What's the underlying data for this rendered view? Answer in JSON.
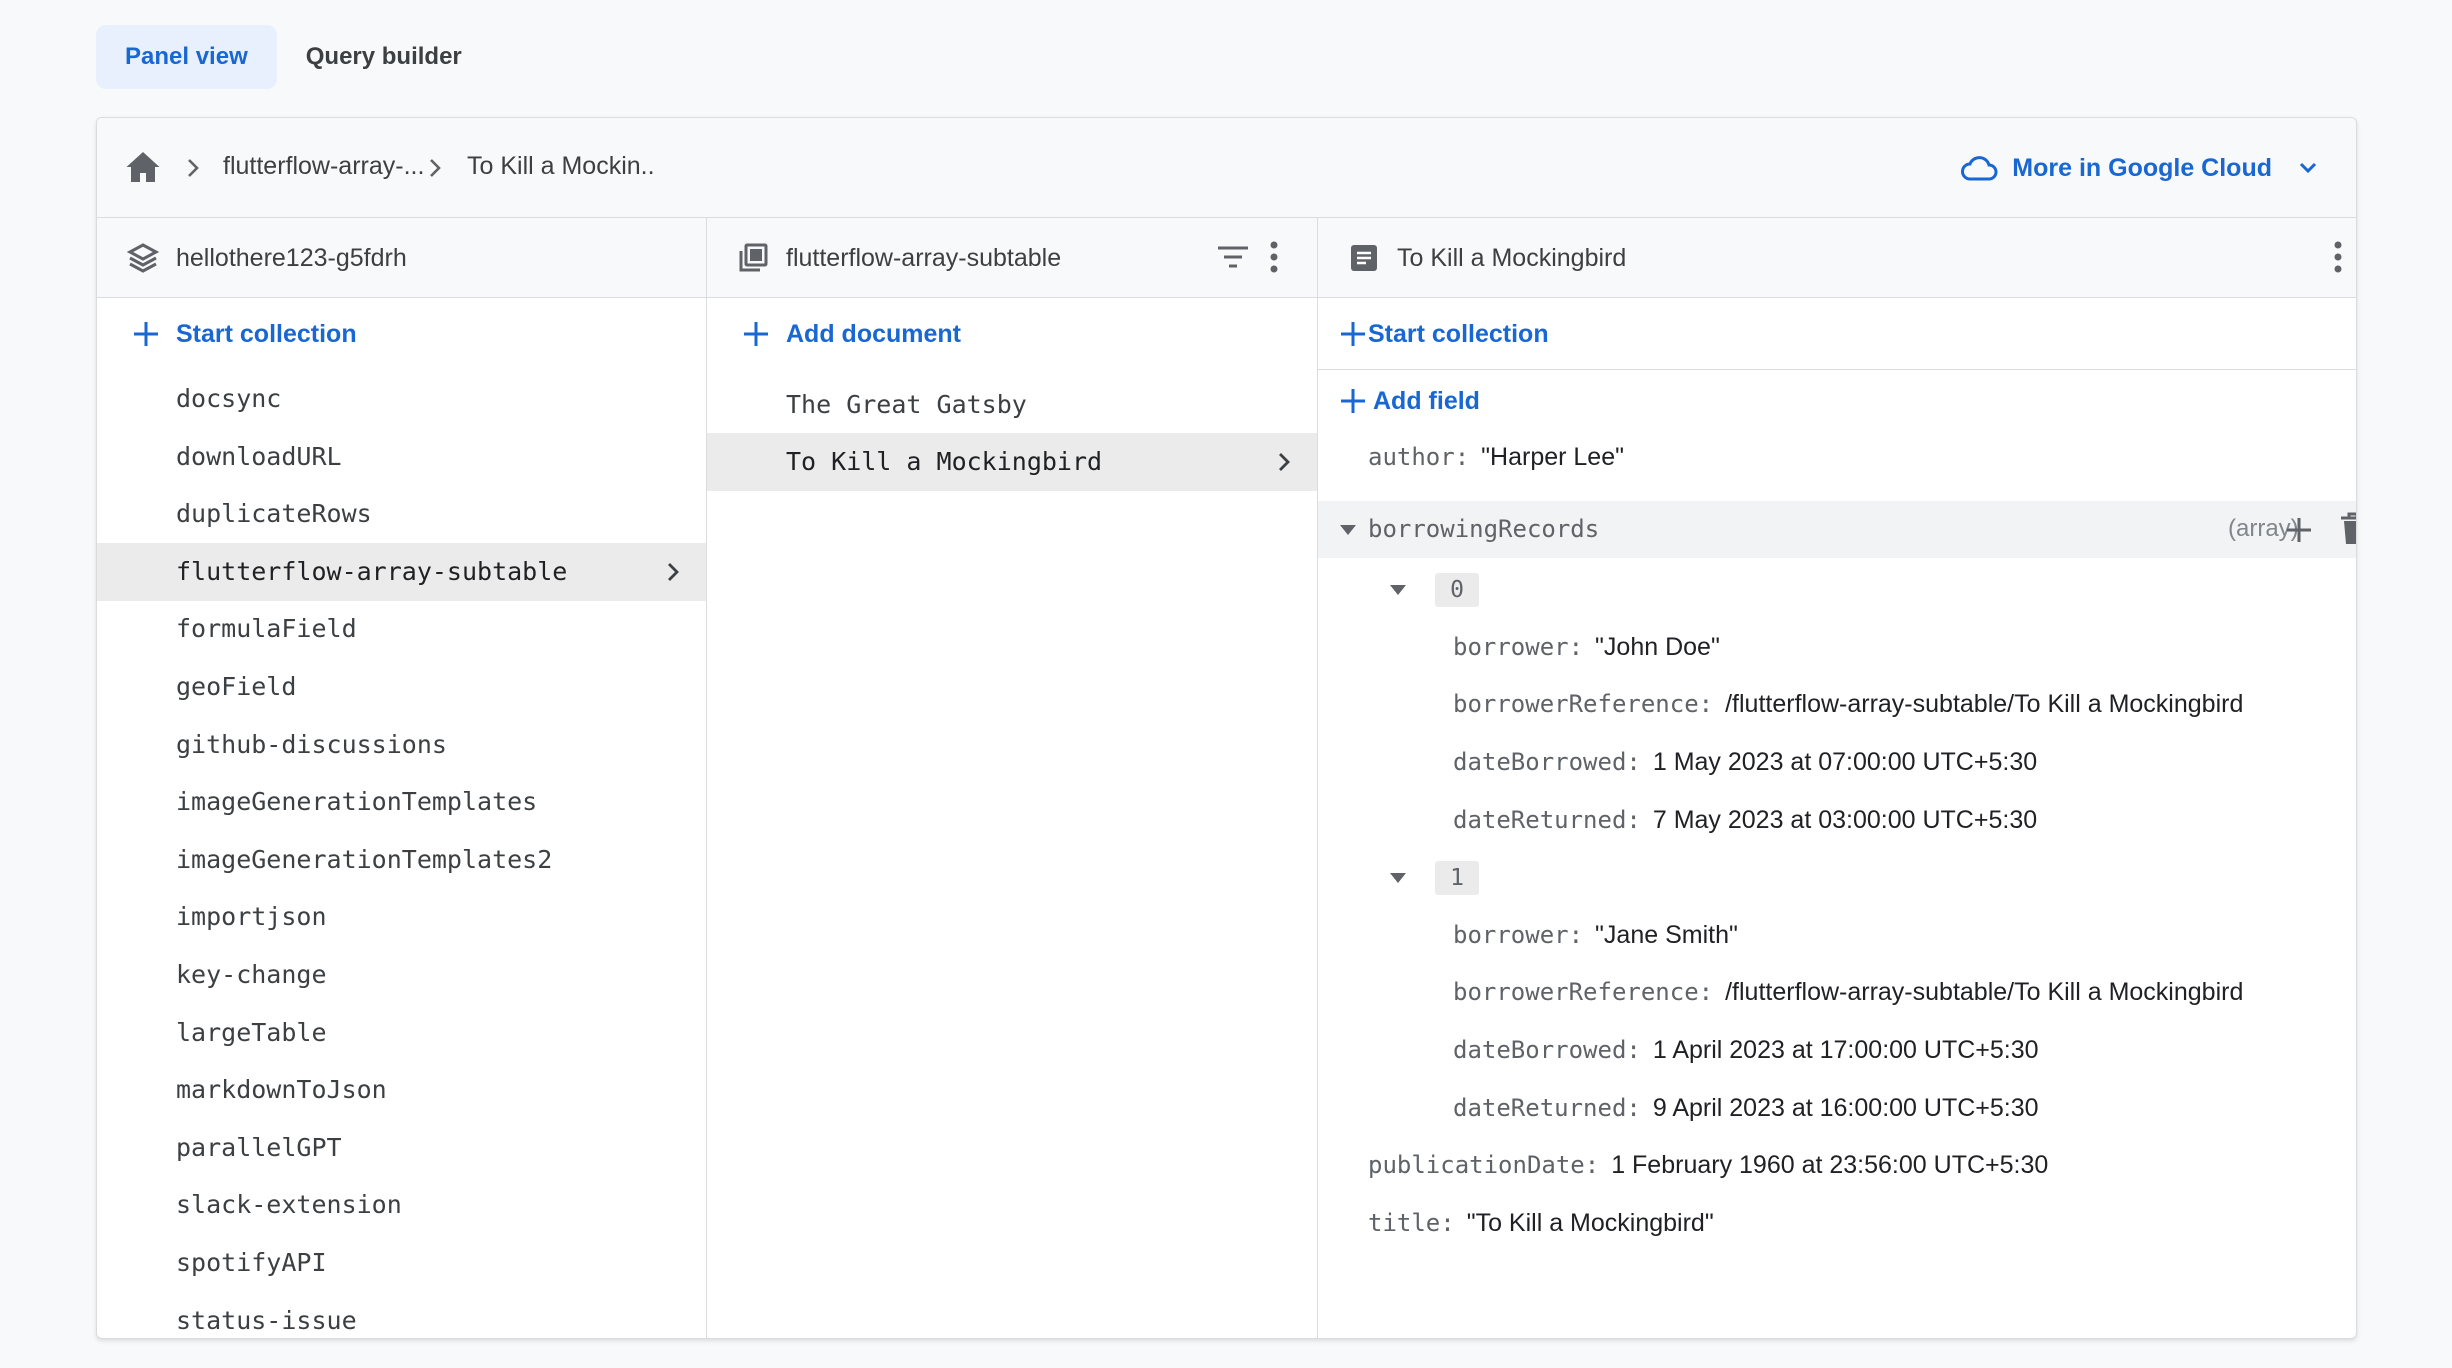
{
  "tabs": [
    {
      "label": "Panel view",
      "active": true
    },
    {
      "label": "Query builder",
      "active": false
    }
  ],
  "breadcrumb": {
    "items": [
      "flutterflow-array-...",
      "To Kill a Mockin.."
    ],
    "more_cloud_label": "More in Google Cloud"
  },
  "colors": {
    "accent": "#1967d2",
    "selected_row": "#ebebeb"
  },
  "col1": {
    "header": "hellothere123-g5fdrh",
    "action": "Start collection",
    "items": [
      "docsync",
      "downloadURL",
      "duplicateRows",
      "flutterflow-array-subtable",
      "formulaField",
      "geoField",
      "github-discussions",
      "imageGenerationTemplates",
      "imageGenerationTemplates2",
      "importjson",
      "key-change",
      "largeTable",
      "markdownToJson",
      "parallelGPT",
      "slack-extension",
      "spotifyAPI",
      "status-issue"
    ],
    "selected_index": 3
  },
  "col2": {
    "header": "flutterflow-array-subtable",
    "action": "Add document",
    "items": [
      "The Great Gatsby",
      "To Kill a Mockingbird"
    ],
    "selected_index": 1
  },
  "col3": {
    "header": "To Kill a Mockingbird",
    "start_collection": "Start collection",
    "add_field": "Add field",
    "author": {
      "key": "author:",
      "value": "\"Harper Lee\""
    },
    "borrowing": {
      "key": "borrowingRecords",
      "type": "(array)"
    },
    "records": [
      {
        "index": "0",
        "borrower": {
          "key": "borrower:",
          "value": "\"John Doe\""
        },
        "borrowerReference": {
          "key": "borrowerReference:",
          "value": "/flutterflow-array-subtable/To Kill a Mockingbird"
        },
        "dateBorrowed": {
          "key": "dateBorrowed:",
          "value": "1 May 2023 at 07:00:00 UTC+5:30"
        },
        "dateReturned": {
          "key": "dateReturned:",
          "value": "7 May 2023 at 03:00:00 UTC+5:30"
        }
      },
      {
        "index": "1",
        "borrower": {
          "key": "borrower:",
          "value": "\"Jane Smith\""
        },
        "borrowerReference": {
          "key": "borrowerReference:",
          "value": "/flutterflow-array-subtable/To Kill a Mockingbird"
        },
        "dateBorrowed": {
          "key": "dateBorrowed:",
          "value": "1 April 2023 at 17:00:00 UTC+5:30"
        },
        "dateReturned": {
          "key": "dateReturned:",
          "value": "9 April 2023 at 16:00:00 UTC+5:30"
        }
      }
    ],
    "publicationDate": {
      "key": "publicationDate:",
      "value": "1 February 1960 at 23:56:00 UTC+5:30"
    },
    "title": {
      "key": "title:",
      "value": "\"To Kill a Mockingbird\""
    }
  }
}
